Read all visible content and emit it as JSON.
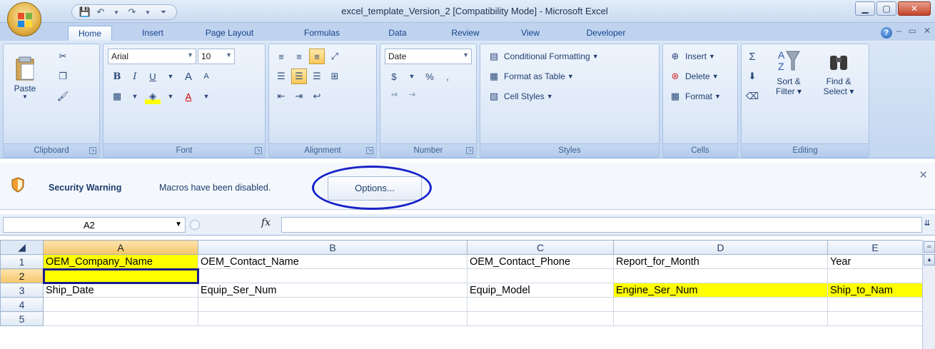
{
  "window": {
    "title": "excel_template_Version_2  [Compatibility Mode] - Microsoft Excel"
  },
  "qat": {
    "items": [
      "save-icon",
      "undo-icon",
      "redo-icon",
      "customize-icon"
    ]
  },
  "tabs": [
    "Home",
    "Insert",
    "Page Layout",
    "Formulas",
    "Data",
    "Review",
    "View",
    "Developer"
  ],
  "ribbon": {
    "clipboard": {
      "label": "Clipboard",
      "paste": "Paste"
    },
    "font": {
      "label": "Font",
      "name": "Arial",
      "size": "10"
    },
    "alignment": {
      "label": "Alignment"
    },
    "number": {
      "label": "Number",
      "format": "Date"
    },
    "styles": {
      "label": "Styles",
      "conditional": "Conditional Formatting",
      "format_table": "Format as Table",
      "cell_styles": "Cell Styles"
    },
    "cells": {
      "label": "Cells",
      "insert": "Insert",
      "delete": "Delete",
      "format": "Format"
    },
    "editing": {
      "label": "Editing",
      "sort": "Sort &",
      "sort2": "Filter",
      "find": "Find &",
      "find2": "Select"
    }
  },
  "security": {
    "title": "Security Warning",
    "message": "Macros have been disabled.",
    "button": "Options..."
  },
  "formula_bar": {
    "name_box": "A2",
    "fx": "fx",
    "value": ""
  },
  "sheet": {
    "columns": [
      "A",
      "B",
      "C",
      "D",
      "E"
    ],
    "rows": [
      {
        "num": "1",
        "cells": [
          "OEM_Company_Name",
          "OEM_Contact_Name",
          "OEM_Contact_Phone",
          "Report_for_Month",
          "Year"
        ]
      },
      {
        "num": "2",
        "cells": [
          "",
          "",
          "",
          "",
          ""
        ]
      },
      {
        "num": "3",
        "cells": [
          "Ship_Date",
          "Equip_Ser_Num",
          "Equip_Model",
          "Engine_Ser_Num",
          "Ship_to_Nam"
        ]
      },
      {
        "num": "4",
        "cells": [
          "",
          "",
          "",
          "",
          ""
        ]
      },
      {
        "num": "5",
        "cells": [
          "",
          "",
          "",
          "",
          ""
        ]
      }
    ]
  },
  "colors": {
    "highlight_yellow": "#ffff00",
    "ring": "#1822c8",
    "ribbon_bg": "#dbe7f7"
  }
}
